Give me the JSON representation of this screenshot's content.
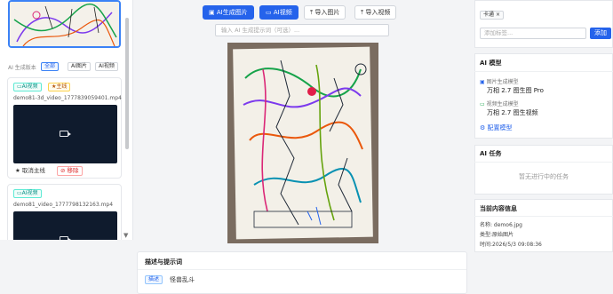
{
  "toolbar": {
    "ai_generate_image": "AI生成图片",
    "ai_video": "AI视频",
    "import_image": "导入图片",
    "import_video": "导入视频",
    "prompt_placeholder": "输入 AI 生成提示词（可选）..."
  },
  "versions": {
    "label": "AI 生成版本",
    "filters": [
      "全部",
      "AI图片",
      "AI视频"
    ],
    "items": [
      {
        "type_badge": "AI视频",
        "main_badge": "主线",
        "filename": "demo81-3d_video_1777839059401.mp4",
        "unset_main": "取消主线",
        "remove": "移除"
      },
      {
        "type_badge": "AI视频",
        "filename": "demo81_video_1777798132163.mp4"
      }
    ]
  },
  "description": {
    "title": "描述与提示词",
    "tag": "描述",
    "text": "怪兽乱斗"
  },
  "tags": {
    "items": [
      "卡通"
    ],
    "input_placeholder": "添加标签...",
    "add_button": "添加"
  },
  "ai_model": {
    "title": "AI 模型",
    "image_model_label": "图片生成模型",
    "image_model_value": "万相 2.7 图生图 Pro",
    "video_model_label": "视频生成模型",
    "video_model_value": "万相 2.7 图生视频",
    "configure": "配置模型"
  },
  "ai_tasks": {
    "title": "AI 任务",
    "empty": "暂无进行中的任务"
  },
  "content_info": {
    "title": "当前内容信息",
    "name": "名称: demo6.jpg",
    "type": "类型:原始图片",
    "time": "时间:2026/5/3 09:08:36"
  },
  "colors": {
    "accent": "#2563eb",
    "video_bg": "#0f1b2d",
    "danger": "#dc2626"
  }
}
